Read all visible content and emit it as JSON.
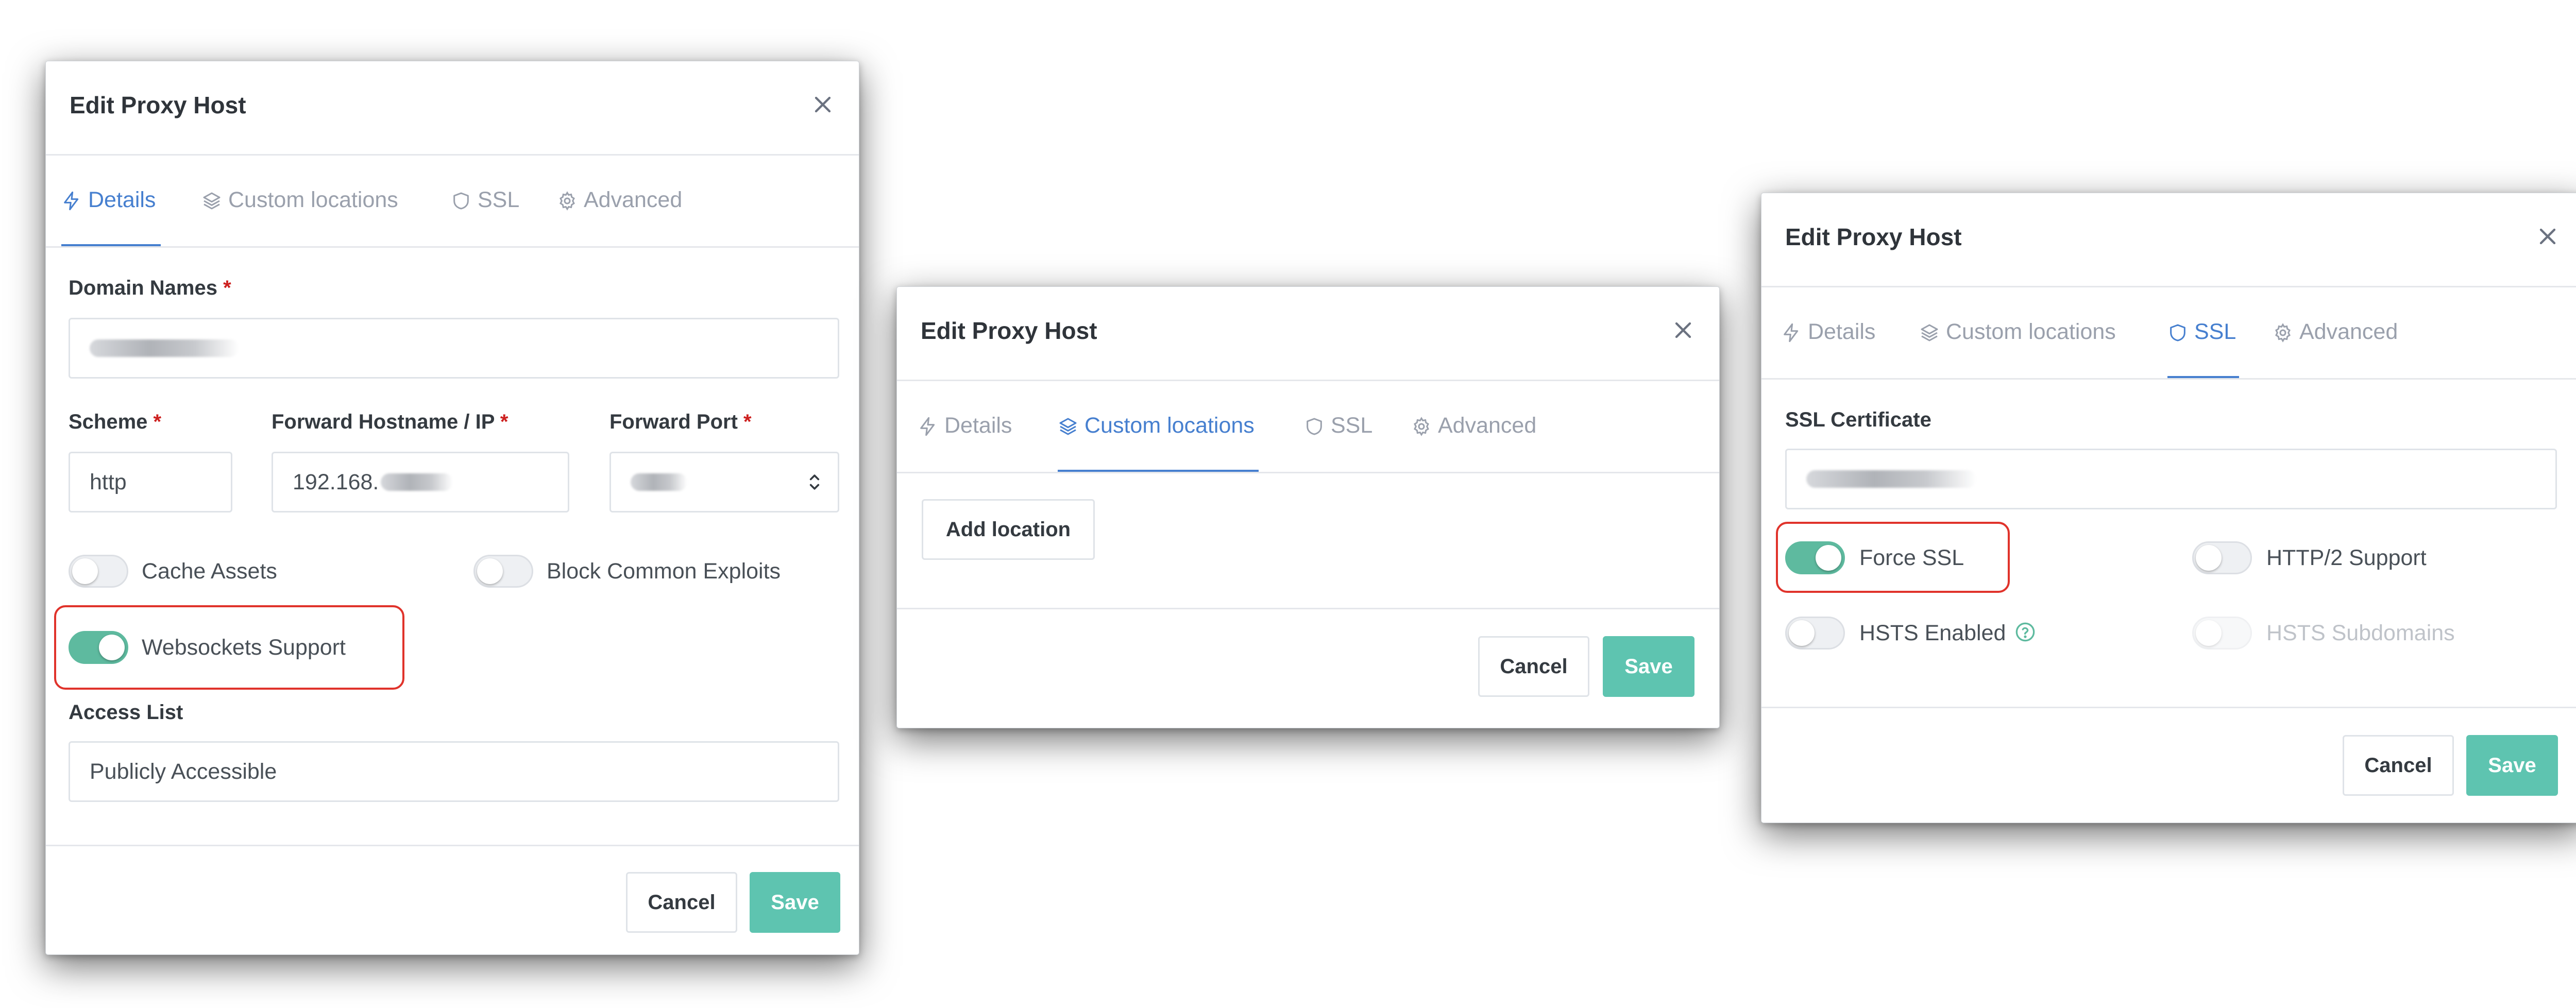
{
  "colors": {
    "accent": "#467fcf",
    "toggle_on": "#5eba9f",
    "save": "#5ec4b0",
    "required": "#cd201f",
    "highlight": "#e0332b"
  },
  "icons": {
    "details": "bolt-icon",
    "custom_locations": "layers-icon",
    "ssl": "shield-icon",
    "advanced": "gear-icon",
    "close": "close-icon",
    "help": "help-circle-icon",
    "stepper": "up-down-stepper-icon"
  },
  "modal1": {
    "title": "Edit Proxy Host",
    "tabs": [
      "Details",
      "Custom locations",
      "SSL",
      "Advanced"
    ],
    "active_tab": "Details",
    "domain_label": "Domain Names",
    "required_mark": "*",
    "scheme_label": "Scheme",
    "scheme_value": "http",
    "hostname_label": "Forward Hostname / IP",
    "hostname_value": "192.168.",
    "port_label": "Forward Port",
    "cache_label": "Cache Assets",
    "cache_on": false,
    "exploits_label": "Block Common Exploits",
    "exploits_on": false,
    "websockets_label": "Websockets Support",
    "websockets_on": true,
    "access_label": "Access List",
    "access_value": "Publicly Accessible",
    "cancel": "Cancel",
    "save": "Save"
  },
  "modal2": {
    "title": "Edit Proxy Host",
    "tabs": [
      "Details",
      "Custom locations",
      "SSL",
      "Advanced"
    ],
    "active_tab": "Custom locations",
    "add_location": "Add location",
    "cancel": "Cancel",
    "save": "Save"
  },
  "modal3": {
    "title": "Edit Proxy Host",
    "tabs": [
      "Details",
      "Custom locations",
      "SSL",
      "Advanced"
    ],
    "active_tab": "SSL",
    "cert_label": "SSL Certificate",
    "force_ssl_label": "Force SSL",
    "force_ssl_on": true,
    "http2_label": "HTTP/2 Support",
    "http2_on": false,
    "hsts_label": "HSTS Enabled",
    "hsts_on": false,
    "hsts_sub_label": "HSTS Subdomains",
    "hsts_sub_on": false,
    "cancel": "Cancel",
    "save": "Save"
  }
}
